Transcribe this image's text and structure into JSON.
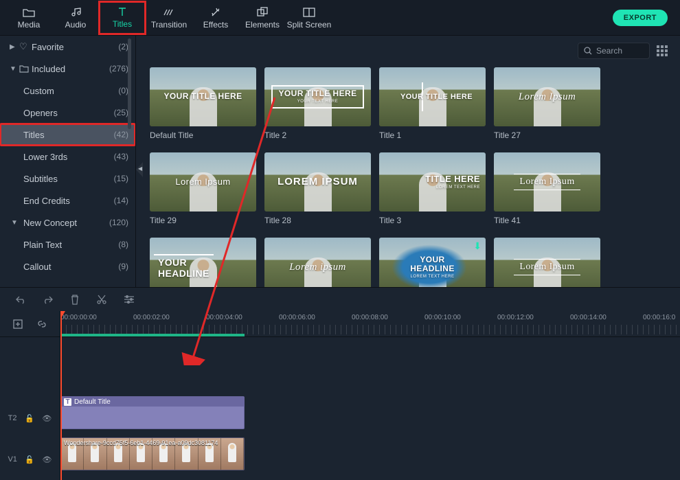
{
  "tabs": [
    {
      "id": "media",
      "label": "Media"
    },
    {
      "id": "audio",
      "label": "Audio"
    },
    {
      "id": "titles",
      "label": "Titles"
    },
    {
      "id": "transition",
      "label": "Transition"
    },
    {
      "id": "effects",
      "label": "Effects"
    },
    {
      "id": "elements",
      "label": "Elements"
    },
    {
      "id": "splitscreen",
      "label": "Split Screen"
    }
  ],
  "export_label": "EXPORT",
  "search_placeholder": "Search",
  "sidebar": {
    "favorite": {
      "label": "Favorite",
      "count": "(2)"
    },
    "included": {
      "label": "Included",
      "count": "(276)"
    },
    "items": [
      {
        "label": "Custom",
        "count": "(0)"
      },
      {
        "label": "Openers",
        "count": "(25)"
      },
      {
        "label": "Titles",
        "count": "(42)"
      },
      {
        "label": "Lower 3rds",
        "count": "(43)"
      },
      {
        "label": "Subtitles",
        "count": "(15)"
      },
      {
        "label": "End Credits",
        "count": "(14)"
      },
      {
        "label": "New Concept",
        "count": "(120)"
      },
      {
        "label": "Plain Text",
        "count": "(8)"
      },
      {
        "label": "Callout",
        "count": "(9)"
      }
    ]
  },
  "thumbs": [
    {
      "caption": "Default Title",
      "overlay": "YOUR TITLE HERE",
      "style": "plain"
    },
    {
      "caption": "Title 2",
      "overlay": "YOUR TITLE HERE",
      "sub": "YOUR TEXT HERE",
      "style": "box"
    },
    {
      "caption": "Title 1",
      "overlay": "YOUR TITLE HERE",
      "style": "vbar"
    },
    {
      "caption": "Title 27",
      "overlay": "Lorem Ipsum",
      "style": "script"
    },
    {
      "caption": "Title 29",
      "overlay": "Lorem Ipsum",
      "style": "thin"
    },
    {
      "caption": "Title 28",
      "overlay": "LOREM IPSUM",
      "style": "tall"
    },
    {
      "caption": "Title 3",
      "overlay": "TITLE HERE",
      "sub": "LOREM TEXT HERE",
      "style": "right"
    },
    {
      "caption": "Title 41",
      "overlay": "Lorem Ipsum",
      "style": "serif"
    },
    {
      "caption": "",
      "overlay": "YOUR\nHEADLINE",
      "style": "headline"
    },
    {
      "caption": "",
      "overlay": "Lorem ipsum",
      "style": "scriptlow"
    },
    {
      "caption": "",
      "overlay": "YOUR\nHEADLINE",
      "sub": "LOREM TEXT HERE",
      "style": "splash",
      "download": true
    },
    {
      "caption": "",
      "overlay": "Lorem Ipsum",
      "style": "serif2"
    }
  ],
  "timeline": {
    "marks": [
      "00:00:00:00",
      "00:00:02:00",
      "00:00:04:00",
      "00:00:06:00",
      "00:00:08:00",
      "00:00:10:00",
      "00:00:12:00",
      "00:00:14:00",
      "00:00:16:0"
    ],
    "title_clip": {
      "label": "Default Title",
      "icon": "T"
    },
    "video_clip": {
      "filename": "Wondershare-9ccd75f5-6eb1-4469-91ea-a09dc3081174"
    },
    "track_t": "T2",
    "track_v": "V1"
  }
}
